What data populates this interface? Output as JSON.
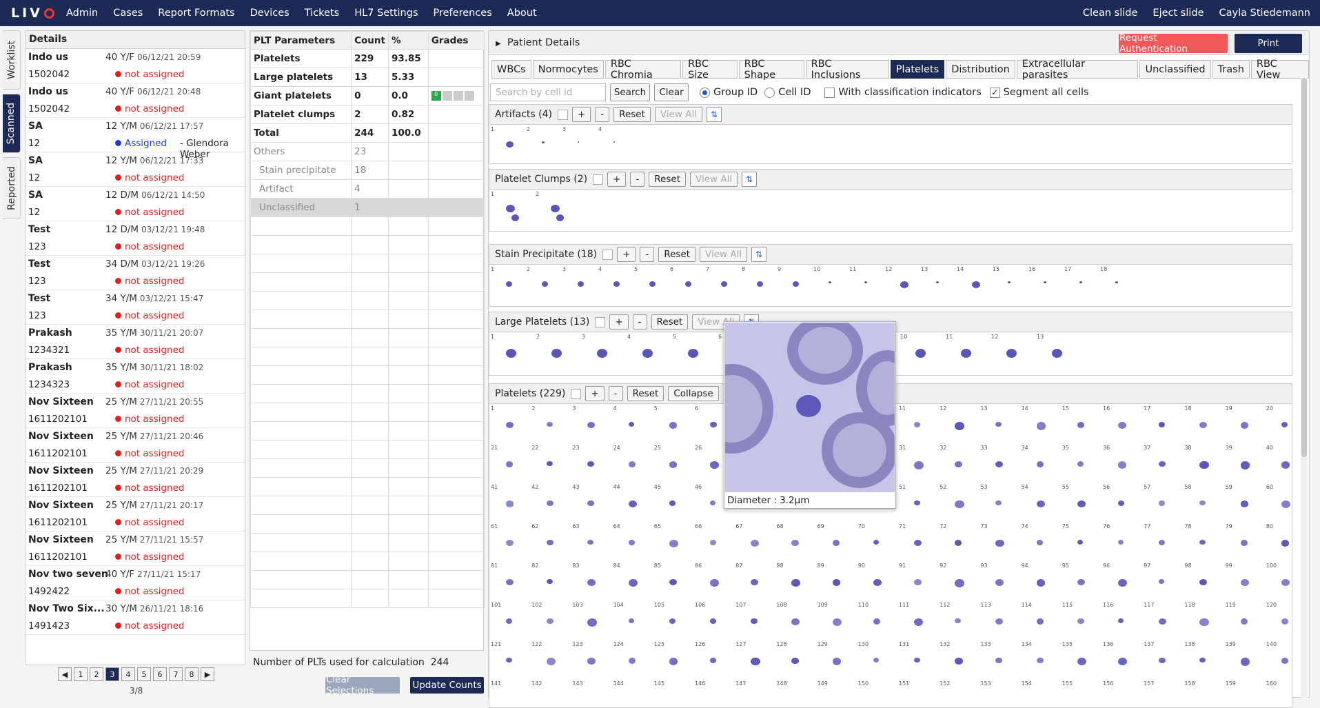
{
  "app": {
    "logo": "LIVO"
  },
  "nav": [
    "Admin",
    "Cases",
    "Report Formats",
    "Devices",
    "Tickets",
    "HL7 Settings",
    "Preferences",
    "About"
  ],
  "topright": {
    "clean": "Clean slide",
    "eject": "Eject slide",
    "user": "Cayla Stiedemann"
  },
  "vtabs": [
    "Worklist",
    "Scanned",
    "Reported"
  ],
  "details": {
    "title": "Details",
    "cases": [
      {
        "name": "Indo us",
        "age": "40 Y/F",
        "date": "06/12/21 20:59",
        "id": "1502042",
        "status": "not assigned"
      },
      {
        "name": "Indo us",
        "age": "40 Y/F",
        "date": "06/12/21 20:48",
        "id": "1502042",
        "status": "not assigned"
      },
      {
        "name": "SA",
        "age": "12 Y/M",
        "date": "06/12/21 17:57",
        "id": "12",
        "status": "Assigned",
        "assignee": "- Glendora Weber"
      },
      {
        "name": "SA",
        "age": "12 Y/M",
        "date": "06/12/21 17:33",
        "id": "12",
        "status": "not assigned"
      },
      {
        "name": "SA",
        "age": "12 D/M",
        "date": "06/12/21 14:50",
        "id": "12",
        "status": "not assigned"
      },
      {
        "name": "Test",
        "age": "12 D/M",
        "date": "03/12/21 19:48",
        "id": "123",
        "status": "not assigned"
      },
      {
        "name": "Test",
        "age": "34 D/M",
        "date": "03/12/21 19:26",
        "id": "123",
        "status": "not assigned"
      },
      {
        "name": "Test",
        "age": "34 Y/M",
        "date": "03/12/21 15:47",
        "id": "123",
        "status": "not assigned"
      },
      {
        "name": "Prakash",
        "age": "35 Y/M",
        "date": "30/11/21 20:07",
        "id": "1234321",
        "status": "not assigned"
      },
      {
        "name": "Prakash",
        "age": "35 Y/M",
        "date": "30/11/21 18:02",
        "id": "1234323",
        "status": "not assigned"
      },
      {
        "name": "Nov Sixteen",
        "age": "25 Y/M",
        "date": "27/11/21 20:55",
        "id": "1611202101",
        "status": "not assigned"
      },
      {
        "name": "Nov Sixteen",
        "age": "25 Y/M",
        "date": "27/11/21 20:46",
        "id": "1611202101",
        "status": "not assigned"
      },
      {
        "name": "Nov Sixteen",
        "age": "25 Y/M",
        "date": "27/11/21 20:29",
        "id": "1611202101",
        "status": "not assigned"
      },
      {
        "name": "Nov Sixteen",
        "age": "25 Y/M",
        "date": "27/11/21 20:17",
        "id": "1611202101",
        "status": "not assigned"
      },
      {
        "name": "Nov Sixteen",
        "age": "25 Y/M",
        "date": "27/11/21 15:57",
        "id": "1611202101",
        "status": "not assigned"
      },
      {
        "name": "Nov two seven",
        "age": "40 Y/F",
        "date": "27/11/21 15:17",
        "id": "1492422",
        "status": "not assigned"
      },
      {
        "name": "Nov Two Six...",
        "age": "30 Y/M",
        "date": "26/11/21 18:16",
        "id": "1491423",
        "status": "not assigned"
      }
    ]
  },
  "pager": {
    "pages": [
      "1",
      "2",
      "3",
      "4",
      "5",
      "6",
      "7",
      "8"
    ],
    "current": "3",
    "label": "3/8",
    "prev": "◀",
    "next": "▶"
  },
  "plt": {
    "headers": [
      "PLT Parameters",
      "Count",
      "%",
      "Grades"
    ],
    "rows": [
      {
        "name": "Platelets",
        "count": "229",
        "pct": "93.85",
        "style": "b"
      },
      {
        "name": "Large platelets",
        "count": "13",
        "pct": "5.33",
        "style": "b"
      },
      {
        "name": "Giant platelets",
        "count": "0",
        "pct": "0.0",
        "style": "b",
        "grade": "0"
      },
      {
        "name": "Platelet clumps",
        "count": "2",
        "pct": "0.82",
        "style": "b"
      },
      {
        "name": "Total",
        "count": "244",
        "pct": "100.0",
        "style": "b"
      },
      {
        "name": "Others",
        "count": "23",
        "pct": "",
        "style": "g"
      },
      {
        "name": "Stain precipitate",
        "count": "18",
        "pct": "",
        "style": "gi"
      },
      {
        "name": "Artifact",
        "count": "4",
        "pct": "",
        "style": "gi"
      },
      {
        "name": "Unclassified",
        "count": "1",
        "pct": "",
        "style": "unc"
      }
    ],
    "footer": "Number of PLTs used for calculation",
    "footer_val": "244",
    "clear": "Clear Selections",
    "update": "Update Counts"
  },
  "patient": {
    "title": "Patient Details",
    "auth": "Request Authentication",
    "print": "Print"
  },
  "tabs": [
    "WBCs",
    "Normocytes",
    "RBC Chromia",
    "RBC Size",
    "RBC Shape",
    "RBC Inclusions",
    "Platelets",
    "Distribution",
    "Extracellular parasites",
    "Unclassified",
    "Trash",
    "RBC View"
  ],
  "active_tab": "Platelets",
  "search": {
    "placeholder": "Search by cell id",
    "search": "Search",
    "clear": "Clear",
    "group": "Group ID",
    "cell": "Cell ID",
    "indicators": "With classification indicators",
    "segment": "Segment all cells"
  },
  "sections": [
    {
      "label": "Artifacts (4)",
      "count": 4
    },
    {
      "label": "Platelet Clumps (2)",
      "count": 2
    },
    {
      "label": "Stain Precipitate (18)",
      "count": 18
    },
    {
      "label": "Large Platelets (13)",
      "count": 13
    },
    {
      "label": "Platelets (229)",
      "count": 160
    }
  ],
  "section_buttons": {
    "plus": "+",
    "minus": "-",
    "reset": "Reset",
    "view": "View All",
    "collapse": "Collapse"
  },
  "popup": {
    "caption": "Diameter : 3.2µm"
  },
  "colors": {
    "navy": "#1c2a55",
    "red": "#e02020",
    "blue": "#1f3ad8",
    "cell": "#5b55b5"
  }
}
